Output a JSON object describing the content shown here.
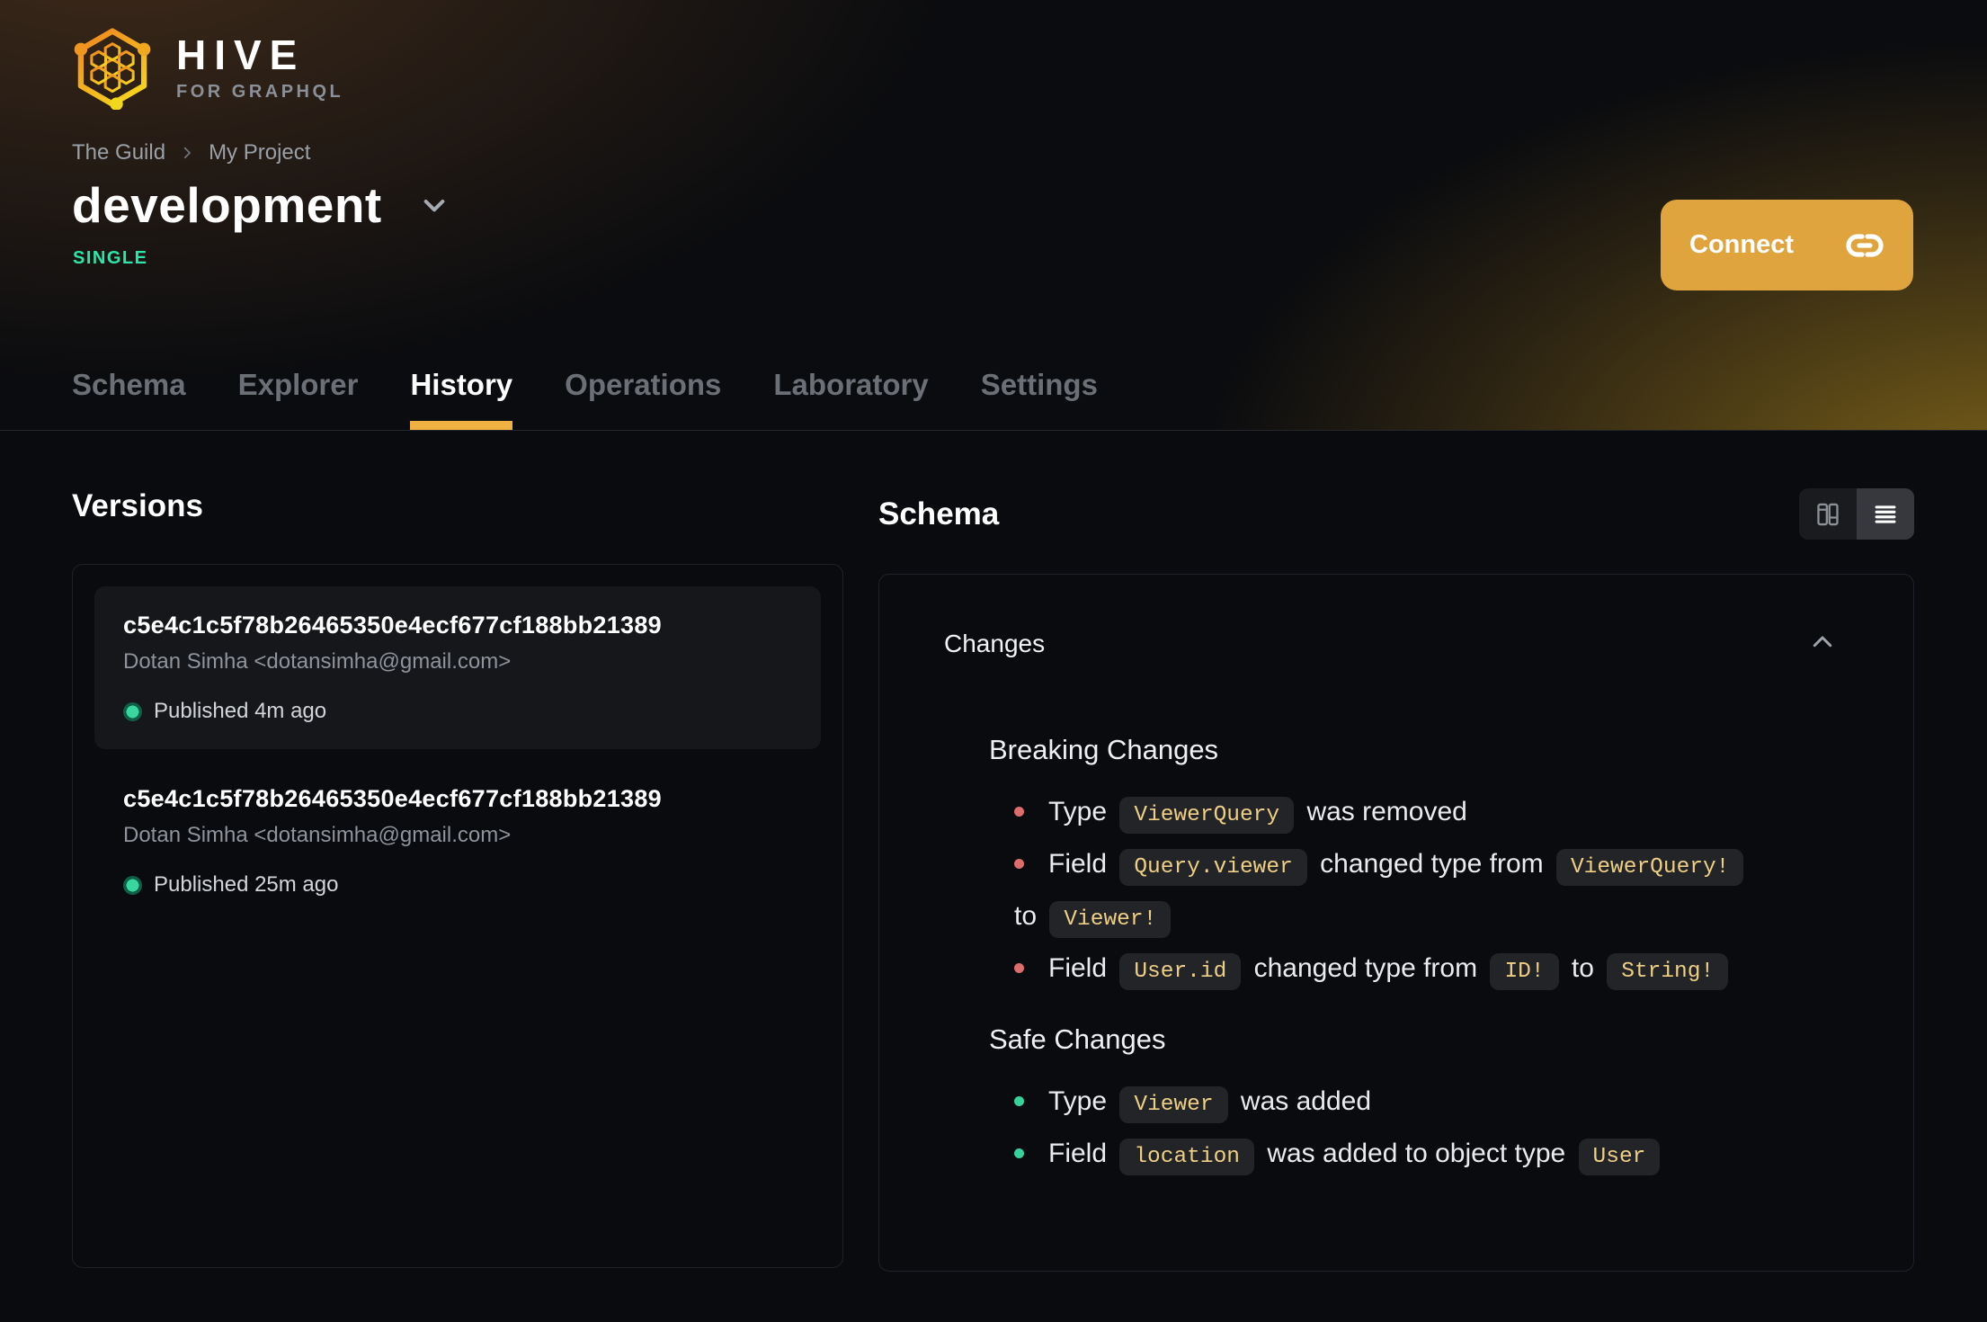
{
  "header": {
    "brand": {
      "name": "HIVE",
      "tagline": "FOR GRAPHQL"
    },
    "breadcrumb": [
      "The Guild",
      "My Project"
    ],
    "target_name": "development",
    "target_badge": "SINGLE",
    "connect_label": "Connect",
    "tabs": [
      "Schema",
      "Explorer",
      "History",
      "Operations",
      "Laboratory",
      "Settings"
    ],
    "active_tab": "History"
  },
  "versions": {
    "title": "Versions",
    "items": [
      {
        "hash": "c5e4c1c5f78b26465350e4ecf677cf188bb21389",
        "author": "Dotan Simha <dotansimha@gmail.com>",
        "status": "Published 4m ago"
      },
      {
        "hash": "c5e4c1c5f78b26465350e4ecf677cf188bb21389",
        "author": "Dotan Simha <dotansimha@gmail.com>",
        "status": "Published 25m ago"
      }
    ]
  },
  "schema": {
    "title": "Schema",
    "changes_header": "Changes",
    "breaking": {
      "title": "Breaking Changes",
      "items": [
        {
          "pre": "Type ",
          "code1": "ViewerQuery",
          "mid1": " was removed"
        },
        {
          "pre": "Field ",
          "code1": "Query.viewer",
          "mid1": " changed type from ",
          "code2": "ViewerQuery!",
          "mid2": "to ",
          "code3": "Viewer!"
        },
        {
          "pre": "Field ",
          "code1": "User.id",
          "mid1": " changed type from ",
          "code2": "ID!",
          "mid2": " to ",
          "code3": "String!"
        }
      ]
    },
    "safe": {
      "title": "Safe Changes",
      "items": [
        {
          "pre": "Type ",
          "code1": "Viewer",
          "mid1": " was added"
        },
        {
          "pre": "Field ",
          "code1": "location",
          "mid1": " was added to object type ",
          "code2": "User"
        }
      ]
    }
  },
  "colors": {
    "accent_amber": "#f0b143",
    "connect_button": "#e0a43e",
    "badge_green": "#2ee5a9",
    "breaking_bullet": "#dd6d6d",
    "safe_bullet": "#35d29b",
    "code_text": "#eecf85"
  }
}
